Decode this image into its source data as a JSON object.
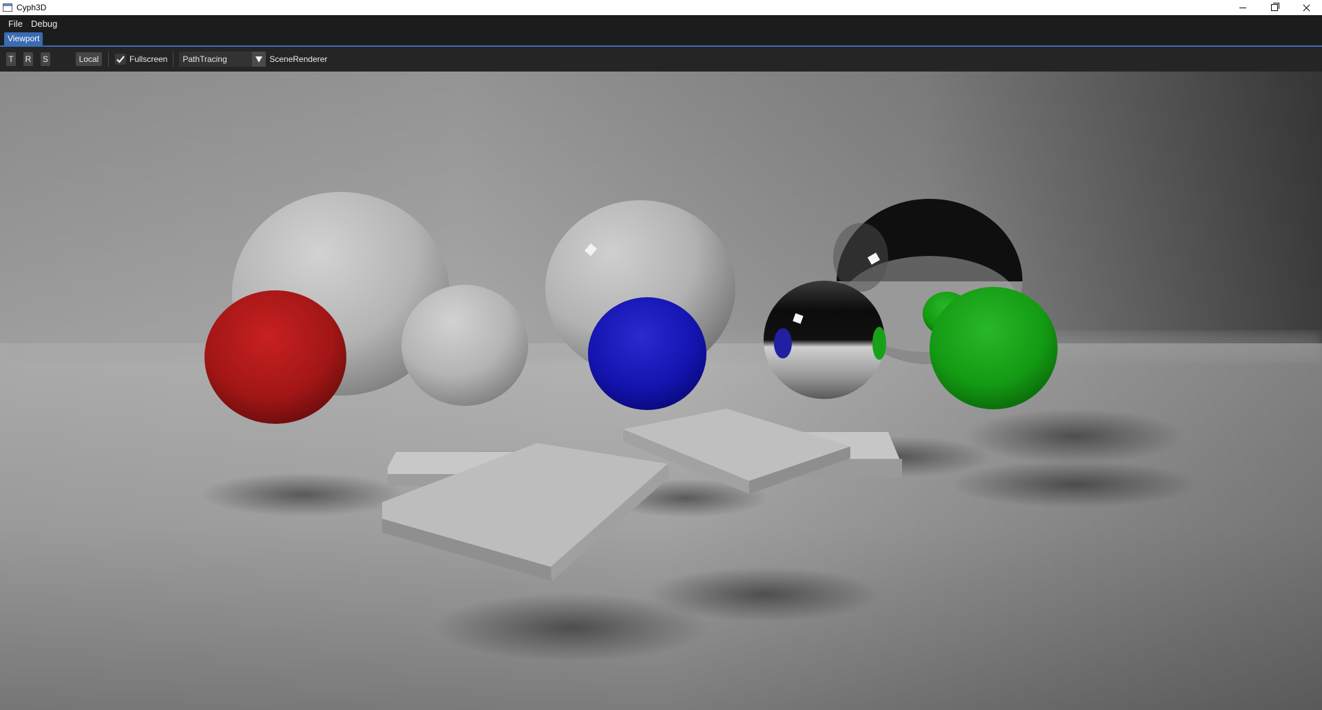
{
  "window": {
    "title": "Cyph3D",
    "controls": [
      "minimize-icon",
      "restore-icon",
      "close-icon"
    ]
  },
  "menu": {
    "items": [
      "File",
      "Debug"
    ]
  },
  "tabs": {
    "active": "Viewport"
  },
  "toolbar": {
    "translate_label": "T",
    "rotate_label": "R",
    "scale_label": "S",
    "space_label": "Local",
    "fullscreen_label": "Fullscreen",
    "fullscreen_checked": true,
    "renderer_value": "PathTracing",
    "renderer_label": "SceneRenderer"
  },
  "colors": {
    "accent": "#3a6bb3",
    "menu_bg": "#1c1c1c",
    "toolbar_bg": "#252525",
    "red_sphere": "#b01818",
    "blue_sphere": "#1010b8",
    "green_sphere": "#10a010"
  }
}
